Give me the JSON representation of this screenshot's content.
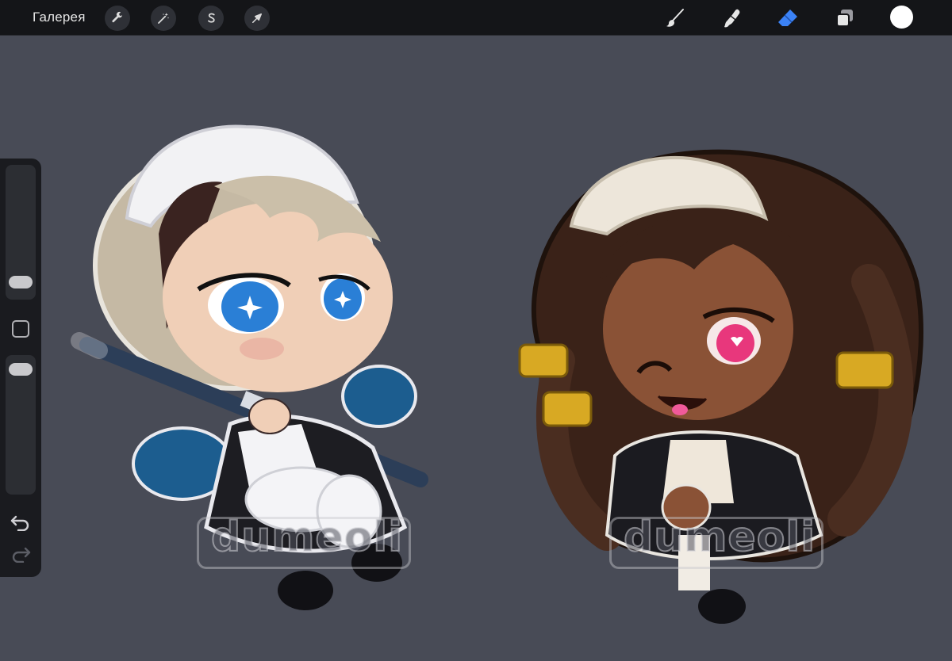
{
  "topbar": {
    "gallery_label": "Галерея",
    "left_tools": [
      {
        "name": "actions",
        "icon": "wrench-icon"
      },
      {
        "name": "adjustments",
        "icon": "magic-wand-icon"
      },
      {
        "name": "selection",
        "icon": "selection-s-icon"
      },
      {
        "name": "transform",
        "icon": "arrow-cursor-icon"
      }
    ],
    "right_tools": [
      {
        "name": "brush",
        "icon": "brush-icon"
      },
      {
        "name": "smudge",
        "icon": "smudge-icon"
      },
      {
        "name": "eraser",
        "icon": "eraser-icon",
        "active": true
      },
      {
        "name": "layers",
        "icon": "layers-icon"
      },
      {
        "name": "color",
        "icon": "color-swatch",
        "value": "#ffffff"
      }
    ],
    "accent_color": "#3b82f6"
  },
  "sidebar": {
    "brush_size_level": 0.2,
    "opacity_level": 0.95,
    "modify_button_icon": "square-icon",
    "undo_icon": "undo-icon",
    "redo_icon": "redo-icon"
  },
  "canvas": {
    "background_color": "#484b56",
    "watermark_text": "dumeoli",
    "artworks": [
      {
        "subject": "chibi maid with mop"
      },
      {
        "subject": "chibi maid with dark hair"
      }
    ]
  }
}
